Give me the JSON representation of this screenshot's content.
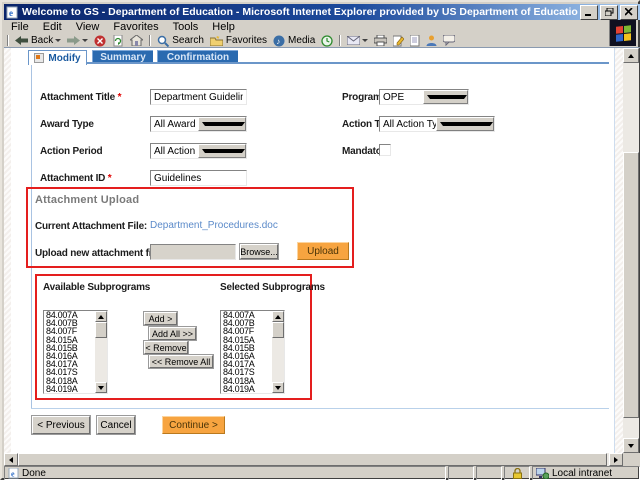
{
  "window": {
    "title": "Welcome to GS - Department of Education - Microsoft Internet Explorer provided by US Department of Education",
    "status_done": "Done",
    "status_zone": "Local intranet"
  },
  "menu": {
    "items": [
      "File",
      "Edit",
      "View",
      "Favorites",
      "Tools",
      "Help"
    ]
  },
  "toolbar": {
    "back": "Back",
    "search": "Search",
    "favorites": "Favorites",
    "media": "Media"
  },
  "tabs": {
    "modify": "Modify",
    "summary": "Summary",
    "confirmation": "Confirmation"
  },
  "form": {
    "required_marker": "*",
    "attachment_title": {
      "label": "Attachment Title",
      "value": "Department Guidelines"
    },
    "program_office": {
      "label": "Program Office",
      "value": "OPE"
    },
    "award_type": {
      "label": "Award Type",
      "value": "All Award Types"
    },
    "action_type": {
      "label": "Action Type",
      "value": "All Action Types"
    },
    "action_period": {
      "label": "Action Period",
      "value": "All Action Periods"
    },
    "mandatory": {
      "label": "Mandatory",
      "checked": false
    },
    "attachment_id": {
      "label": "Attachment ID",
      "value": "Guidelines"
    }
  },
  "upload": {
    "heading": "Attachment Upload",
    "current_label": "Current Attachment File:",
    "current_file": "Department_Procedures.doc",
    "new_label": "Upload new attachment file",
    "browse": "Browse...",
    "upload": "Upload"
  },
  "subprograms": {
    "available_label": "Available Subprograms",
    "selected_label": "Selected Subprograms",
    "add": "Add >",
    "add_all": "Add All >>",
    "remove": "< Remove",
    "remove_all": "<< Remove All",
    "available_items": [
      "84.007A",
      "84.007B",
      "84.007F",
      "84.015A",
      "84.015B",
      "84.016A",
      "84.017A",
      "84.017S",
      "84.018A",
      "84.019A"
    ],
    "selected_items": [
      "84.007A",
      "84.007B",
      "84.007F",
      "84.015A",
      "84.015B",
      "84.016A",
      "84.017A",
      "84.017S",
      "84.018A",
      "84.019A"
    ]
  },
  "footer": {
    "previous": "< Previous",
    "cancel": "Cancel",
    "continue": "Continue >"
  },
  "colors": {
    "tab_blue": "#2a6ab0",
    "active_tab_text": "#19599f",
    "accent_orange": "#f7a440",
    "highlight_red": "#e41e1e",
    "link_blue": "#5b8ac9",
    "title_gradient_start": "#0a246a",
    "title_gradient_end": "#a6caf0"
  }
}
